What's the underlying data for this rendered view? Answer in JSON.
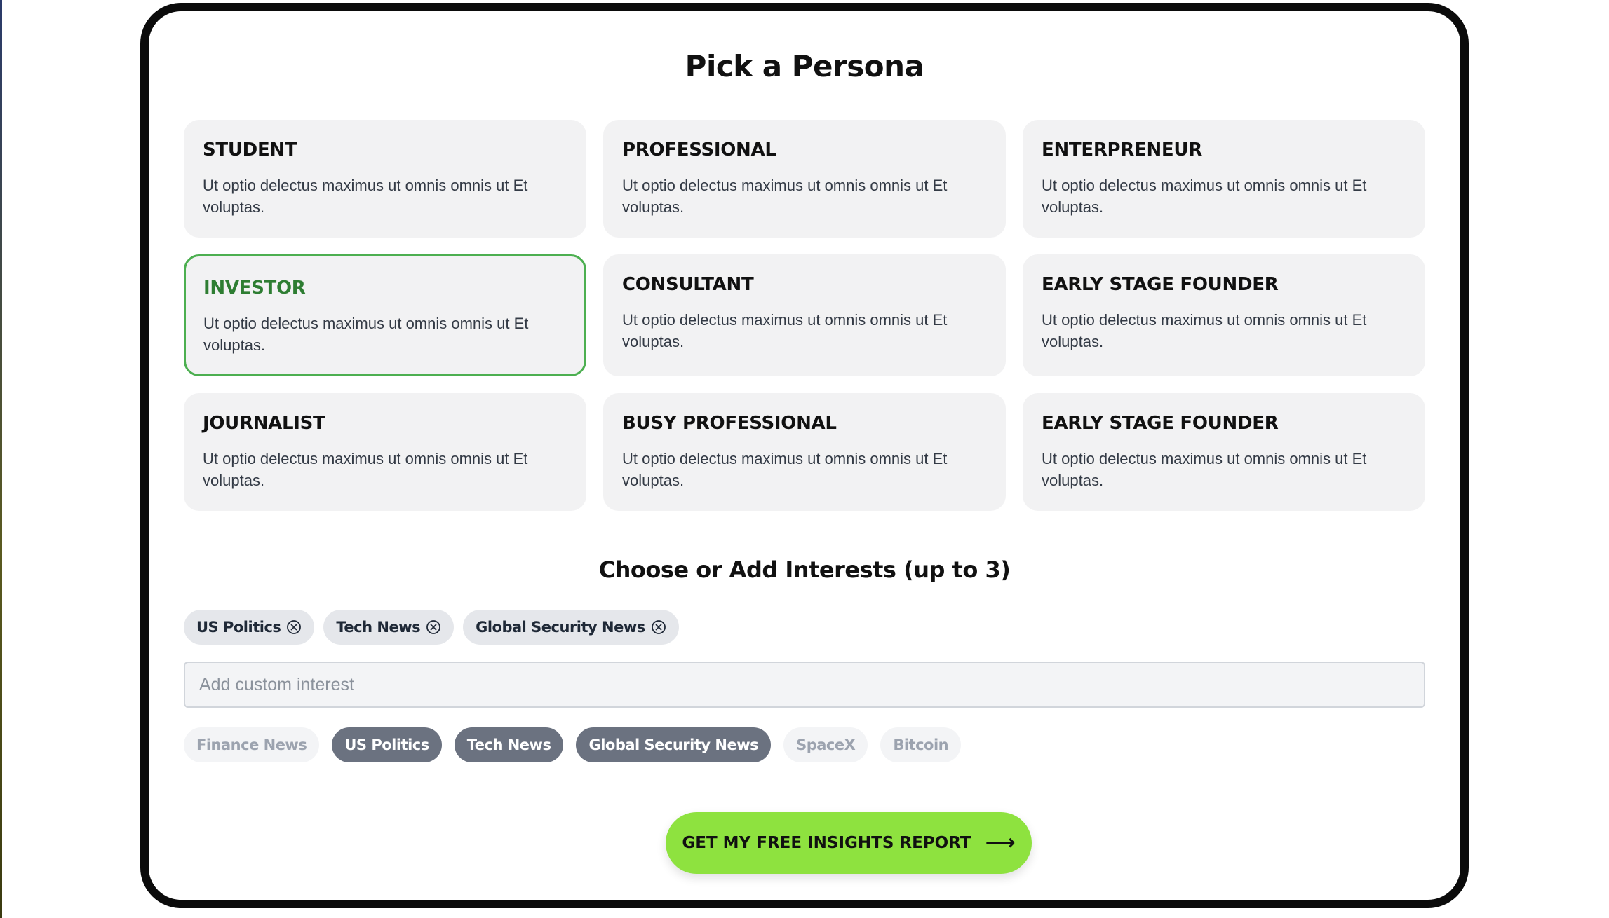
{
  "title": "Pick a Persona",
  "personas": [
    {
      "name": "STUDENT",
      "desc": "Ut optio delectus maximus ut omnis omnis ut Et voluptas.",
      "selected": false
    },
    {
      "name": "PROFESSIONAL",
      "desc": "Ut optio delectus maximus ut omnis omnis ut Et voluptas.",
      "selected": false
    },
    {
      "name": "ENTERPRENEUR",
      "desc": "Ut optio delectus maximus ut omnis omnis ut Et voluptas.",
      "selected": false
    },
    {
      "name": "INVESTOR",
      "desc": "Ut optio delectus maximus ut omnis omnis ut Et voluptas.",
      "selected": true
    },
    {
      "name": "CONSULTANT",
      "desc": "Ut optio delectus maximus ut omnis omnis ut Et voluptas.",
      "selected": false
    },
    {
      "name": "EARLY STAGE FOUNDER",
      "desc": "Ut optio delectus maximus ut omnis omnis ut Et voluptas.",
      "selected": false
    },
    {
      "name": "JOURNALIST",
      "desc": "Ut optio delectus maximus ut omnis omnis ut Et voluptas.",
      "selected": false
    },
    {
      "name": "BUSY PROFESSIONAL",
      "desc": "Ut optio delectus maximus ut omnis omnis ut Et voluptas.",
      "selected": false
    },
    {
      "name": "EARLY STAGE FOUNDER",
      "desc": "Ut optio delectus maximus ut omnis omnis ut Et voluptas.",
      "selected": false
    }
  ],
  "interests": {
    "heading": "Choose or Add Interests (up to 3)",
    "selected": [
      {
        "label": "US Politics",
        "icon": "remove-circle-x-icon"
      },
      {
        "label": "Tech News",
        "icon": "remove-circle-x-icon"
      },
      {
        "label": "Global Security News",
        "icon": "remove-circle-x-icon"
      }
    ],
    "input_placeholder": "Add custom interest",
    "input_value": "",
    "suggestions": [
      {
        "label": "Finance News",
        "active": false
      },
      {
        "label": "US Politics",
        "active": true
      },
      {
        "label": "Tech News",
        "active": true
      },
      {
        "label": "Global Security News",
        "active": true
      },
      {
        "label": "SpaceX",
        "active": false
      },
      {
        "label": "Bitcoin",
        "active": false
      }
    ]
  },
  "cta": {
    "label": "GET MY FREE INSIGHTS REPORT",
    "icon": "arrow-right-icon"
  },
  "colors": {
    "selected_border": "#4caf50",
    "selected_title": "#2e7d32",
    "cta_background": "#8ee23f",
    "active_chip": "#6b7280"
  }
}
